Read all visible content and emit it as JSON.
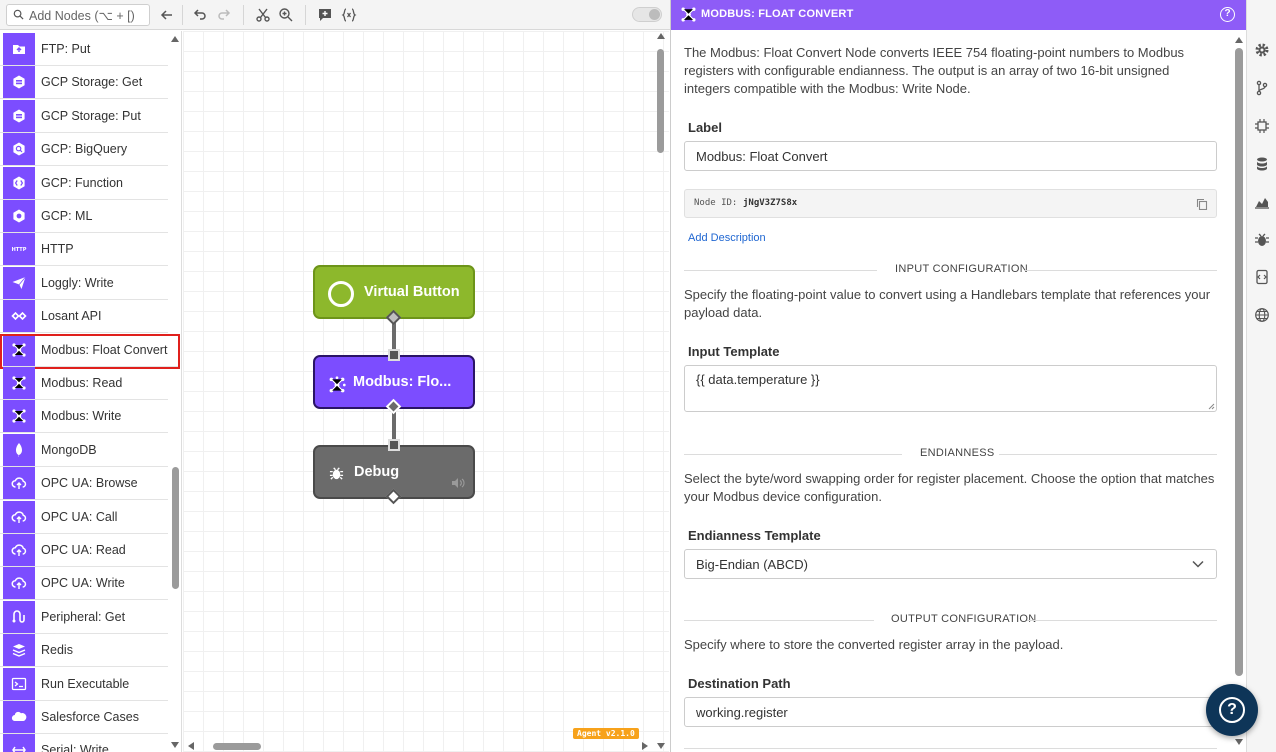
{
  "toolbar": {
    "search_placeholder": "Add Nodes (⌥ + [)",
    "buttons": [
      "collapse-icon",
      "undo-icon",
      "redo-icon",
      "cut-icon",
      "zoom-icon",
      "add-comment-icon",
      "variables-icon"
    ]
  },
  "palette": {
    "items": [
      {
        "label": "FTP: Put",
        "icon": "ftp-icon",
        "selected": false
      },
      {
        "label": "GCP Storage: Get",
        "icon": "gcp-storage-icon",
        "selected": false
      },
      {
        "label": "GCP Storage: Put",
        "icon": "gcp-storage-icon",
        "selected": false
      },
      {
        "label": "GCP: BigQuery",
        "icon": "gcp-bigquery-icon",
        "selected": false
      },
      {
        "label": "GCP: Function",
        "icon": "gcp-function-icon",
        "selected": false
      },
      {
        "label": "GCP: ML",
        "icon": "gcp-ml-icon",
        "selected": false
      },
      {
        "label": "HTTP",
        "icon": "http-icon",
        "selected": false
      },
      {
        "label": "Loggly: Write",
        "icon": "loggly-icon",
        "selected": false
      },
      {
        "label": "Losant API",
        "icon": "losant-icon",
        "selected": false
      },
      {
        "label": "Modbus: Float Convert",
        "icon": "modbus-icon",
        "selected": true
      },
      {
        "label": "Modbus: Read",
        "icon": "modbus-icon",
        "selected": false
      },
      {
        "label": "Modbus: Write",
        "icon": "modbus-icon",
        "selected": false
      },
      {
        "label": "MongoDB",
        "icon": "mongodb-icon",
        "selected": false
      },
      {
        "label": "OPC UA: Browse",
        "icon": "opcua-icon",
        "selected": false
      },
      {
        "label": "OPC UA: Call",
        "icon": "opcua-icon",
        "selected": false
      },
      {
        "label": "OPC UA: Read",
        "icon": "opcua-icon",
        "selected": false
      },
      {
        "label": "OPC UA: Write",
        "icon": "opcua-icon",
        "selected": false
      },
      {
        "label": "Peripheral: Get",
        "icon": "peripheral-icon",
        "selected": false
      },
      {
        "label": "Redis",
        "icon": "redis-icon",
        "selected": false
      },
      {
        "label": "Run Executable",
        "icon": "terminal-icon",
        "selected": false
      },
      {
        "label": "Salesforce Cases",
        "icon": "salesforce-icon",
        "selected": false
      },
      {
        "label": "Serial: Write",
        "icon": "serial-icon",
        "selected": false
      }
    ]
  },
  "canvas": {
    "nodes": [
      {
        "label": "Virtual Button",
        "color": "#8db82c",
        "border": "#6d9419",
        "icon": "virtual-button-icon"
      },
      {
        "label": "Modbus: Flo...",
        "color": "#7c4dff",
        "border": "#2a1466",
        "icon": "modbus-icon"
      },
      {
        "label": "Debug",
        "color": "#6b6b6b",
        "border": "#4a4a4a",
        "icon": "debug-icon"
      }
    ],
    "agent_badge": "Agent v2.1.0"
  },
  "panel": {
    "title": "MODBUS: FLOAT CONVERT",
    "description": "The Modbus: Float Convert Node converts IEEE 754 floating-point numbers to Modbus registers with configurable endianness. The output is an array of two 16-bit unsigned integers compatible with the Modbus: Write Node.",
    "label_heading": "Label",
    "label_value": "Modbus: Float Convert",
    "node_id_key": "Node ID:",
    "node_id_value": "jNgV3Z7S8x",
    "add_description": "Add Description",
    "input_section": "INPUT CONFIGURATION",
    "input_help": "Specify the floating-point value to convert using a Handlebars template that references your payload data.",
    "input_template_heading": "Input Template",
    "input_template_value": "{{ data.temperature }}",
    "endian_section": "ENDIANNESS",
    "endian_help": "Select the byte/word swapping order for register placement. Choose the option that matches your Modbus device configuration.",
    "endian_heading": "Endianness Template",
    "endian_value": "Big-Endian (ABCD)",
    "output_section": "OUTPUT CONFIGURATION",
    "output_help": "Specify where to store the converted register array in the payload.",
    "destination_heading": "Destination Path",
    "destination_value": "working.register"
  },
  "rail": {
    "icons": [
      "settings-icon",
      "version-icon",
      "device-icon",
      "storage-icon",
      "chart-icon",
      "bug-icon",
      "webhook-icon",
      "globe-icon"
    ]
  },
  "colors": {
    "accent": "#8e5cf7",
    "node_purple": "#7c4dff",
    "selected_outline": "#e0201c",
    "help_fab": "#0e3558"
  }
}
